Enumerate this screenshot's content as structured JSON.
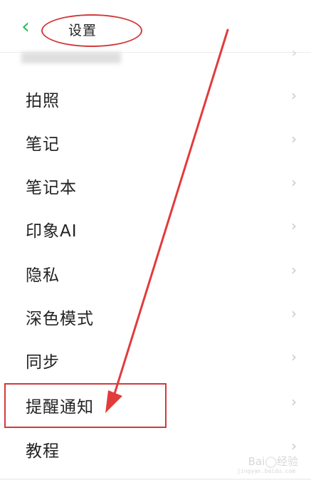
{
  "header": {
    "back_label": "<",
    "title": "设置"
  },
  "settings": {
    "items": [
      {
        "label": "拍照"
      },
      {
        "label": "笔记"
      },
      {
        "label": "笔记本"
      },
      {
        "label": "印象AI"
      },
      {
        "label": "隐私"
      },
      {
        "label": "深色模式"
      },
      {
        "label": "同步"
      },
      {
        "label": "提醒通知"
      },
      {
        "label": "教程"
      }
    ]
  },
  "chevron_glyph": "›",
  "annotation": {
    "color": "#d33a3a",
    "highlighted_item": "提醒通知"
  },
  "watermark": {
    "text": "Bai◯经验",
    "sub": "jingyan.baidu.com"
  }
}
